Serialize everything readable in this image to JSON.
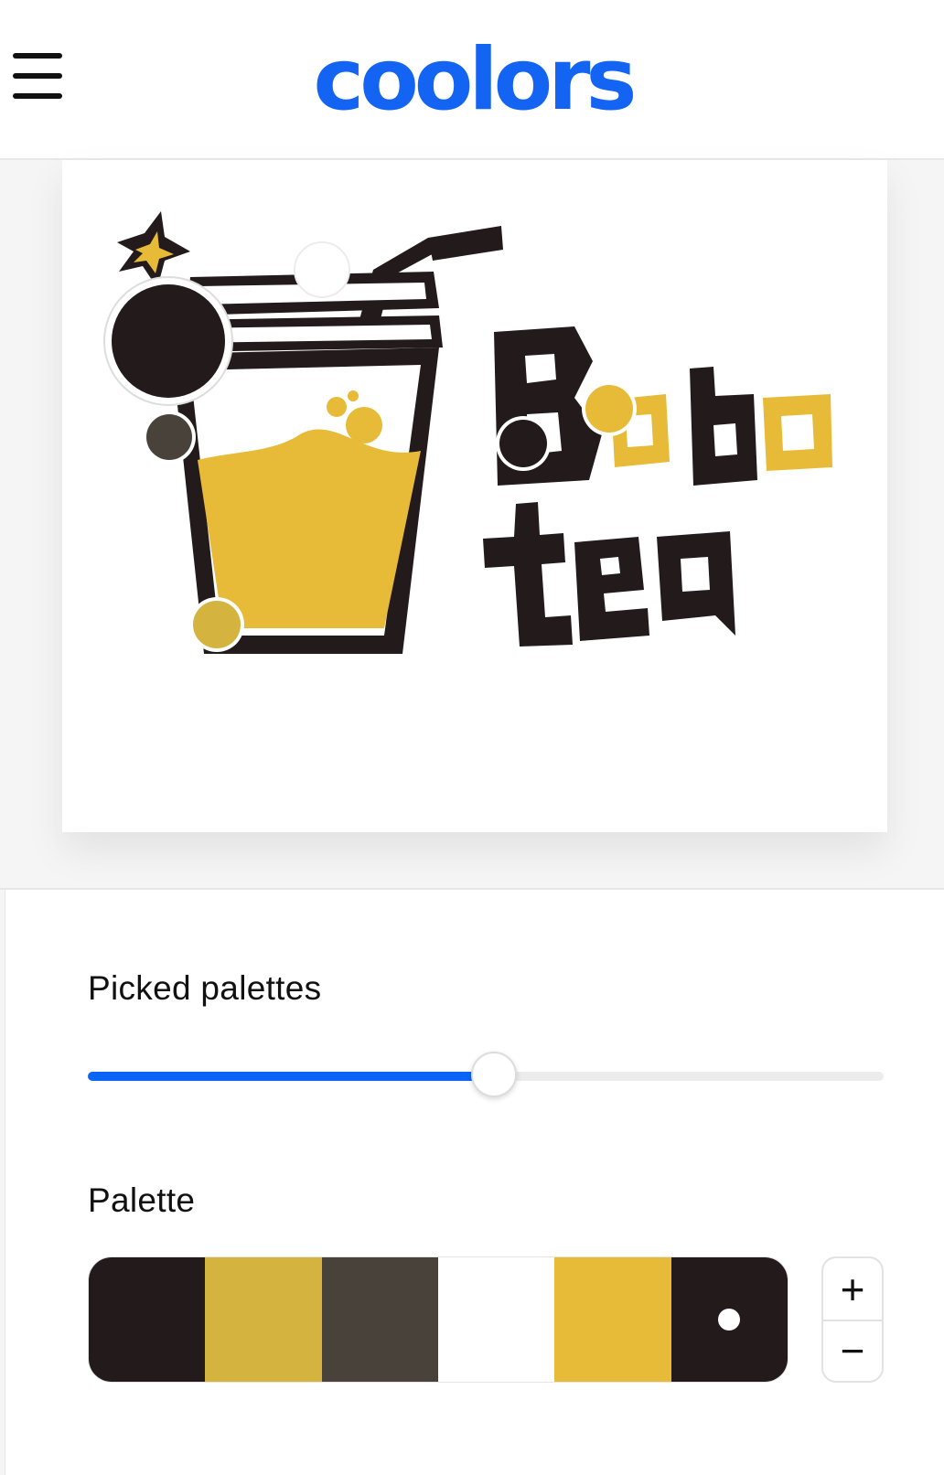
{
  "header": {
    "brand": "coolors",
    "brand_color": "#1464f4",
    "menu_icon": "hamburger-menu-icon"
  },
  "image": {
    "logo_text_line1": "Bobo",
    "logo_text_line2": "tea"
  },
  "picked_palettes": {
    "label": "Picked palettes",
    "slider_value": 0.51,
    "accent": "#0a64f5"
  },
  "palette": {
    "label": "Palette",
    "swatches": [
      "#231a1b",
      "#d4b33f",
      "#48423b",
      "#ffffff",
      "#e7bb38",
      "#231a1b"
    ],
    "selected_index": 5,
    "plus_label": "+",
    "minus_label": "−"
  }
}
